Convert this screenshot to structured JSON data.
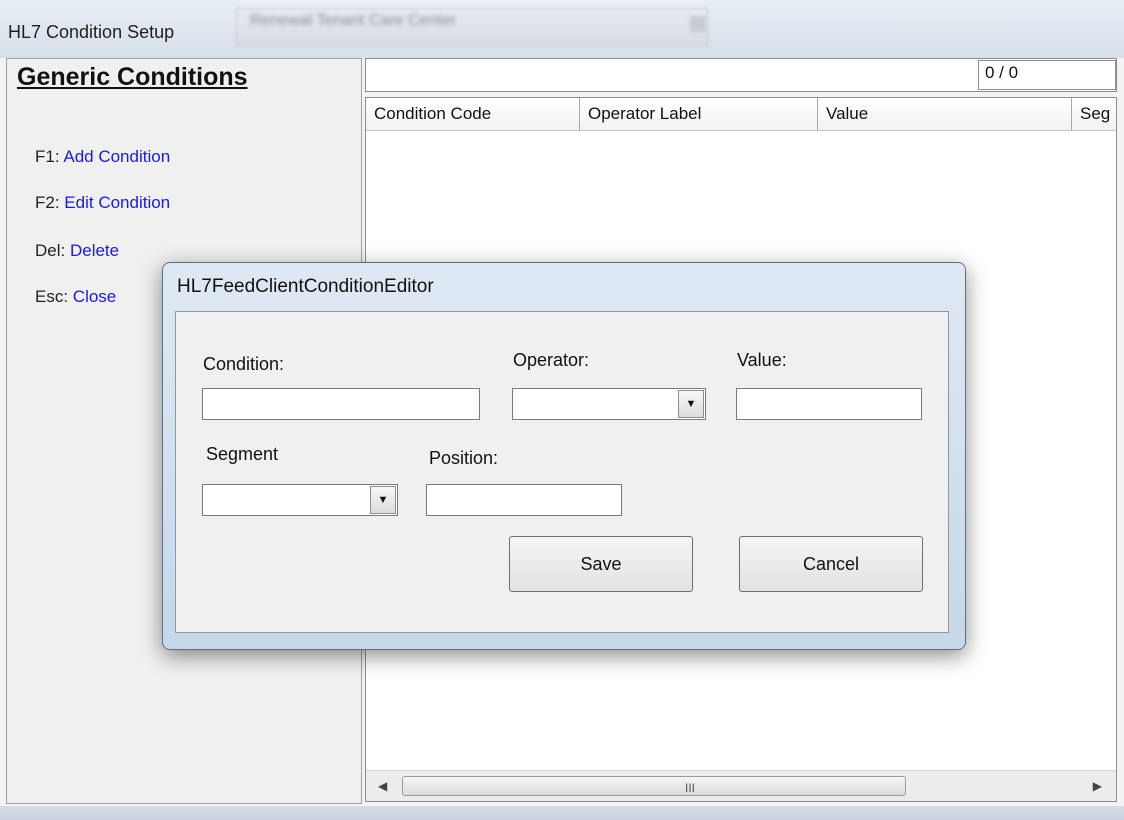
{
  "window": {
    "title": "HL7 Condition Setup",
    "blurred_selector_text": "Renewal Tenant Care Center"
  },
  "left_panel": {
    "heading": "Generic Conditions",
    "hotkeys": [
      {
        "key": "F1:",
        "action": "Add Condition"
      },
      {
        "key": "F2:",
        "action": "Edit Condition"
      },
      {
        "key": "Del:",
        "action": "Delete"
      },
      {
        "key": "Esc:",
        "action": "Close"
      }
    ]
  },
  "grid": {
    "counter": "0 / 0",
    "columns": [
      "Condition Code",
      "Operator Label",
      "Value",
      "Seg"
    ],
    "rows": [],
    "scroll_grip": "III"
  },
  "dialog": {
    "title": "HL7FeedClientConditionEditor",
    "labels": {
      "condition": "Condition:",
      "operator": "Operator:",
      "value": "Value:",
      "segment": "Segment",
      "position": "Position:"
    },
    "values": {
      "condition": "",
      "operator": "",
      "value": "",
      "segment": "",
      "position": ""
    },
    "buttons": {
      "save": "Save",
      "cancel": "Cancel"
    }
  },
  "colors": {
    "hotkey_action": "#1a1ae6",
    "dialog_frame": "#c6d7e8"
  }
}
